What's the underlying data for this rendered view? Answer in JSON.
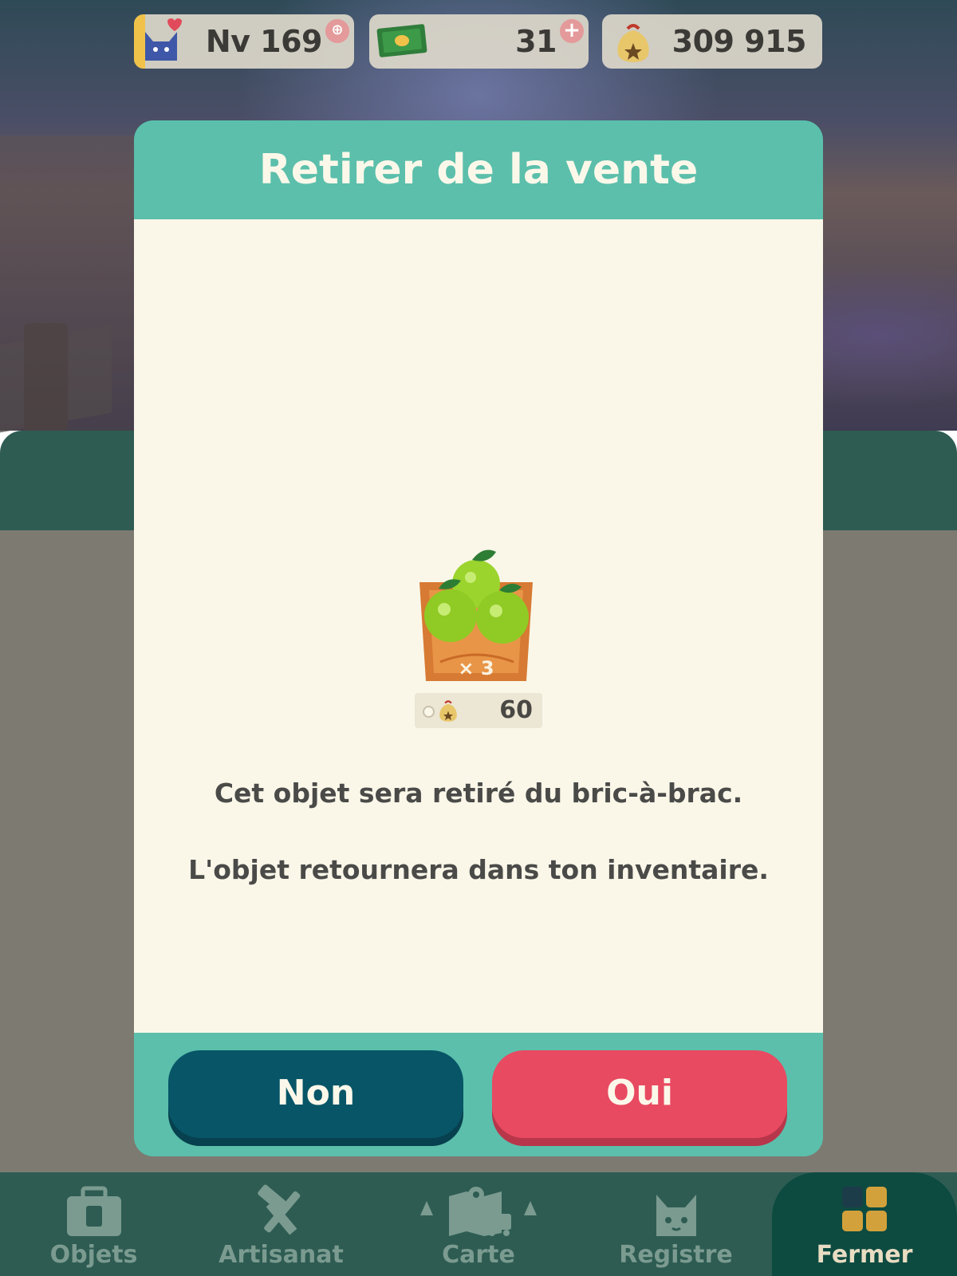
{
  "hud": {
    "level_text": "Nv 169",
    "tickets": "31",
    "bells": "309 915"
  },
  "dialog": {
    "title": "Retirer de la vente",
    "item": {
      "icon": "fruit-basket-icon",
      "quantity": "× 3",
      "price": "60"
    },
    "message_line1": "Cet objet sera retiré du bric-à-brac.",
    "message_line2": "L'objet retournera dans ton inventaire.",
    "buttons": {
      "no": "Non",
      "yes": "Oui"
    }
  },
  "nav": {
    "items": [
      {
        "label": "Objets",
        "icon": "bag-icon"
      },
      {
        "label": "Artisanat",
        "icon": "hammer-saw-icon"
      },
      {
        "label": "Carte",
        "icon": "map-icon"
      },
      {
        "label": "Registre",
        "icon": "cat-icon"
      },
      {
        "label": "Fermer",
        "icon": "grid-icon"
      }
    ]
  },
  "colors": {
    "teal": "#5bbfab",
    "cream": "#faf7e9",
    "non_button": "#075567",
    "oui_button": "#e84a61",
    "nav_bg": "#2e5c52"
  }
}
